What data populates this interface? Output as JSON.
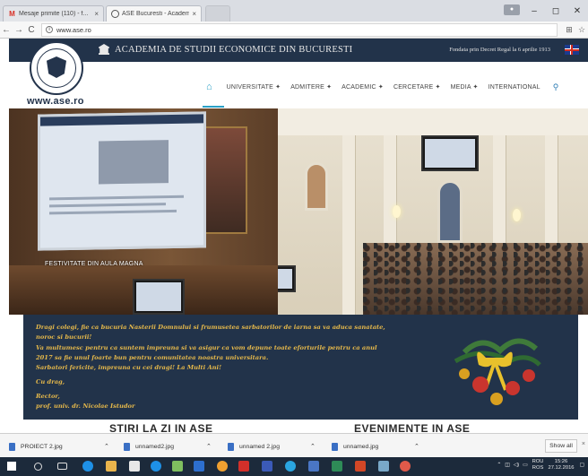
{
  "browser": {
    "tabs": [
      {
        "title": "Mesaje primite (110) - f...",
        "close": "×"
      },
      {
        "title": "ASE Bucuresti - Academ...",
        "close": "×"
      },
      {
        "title": ""
      }
    ],
    "window_buttons": {
      "minimize": "–",
      "maximize": "◻",
      "close": "✕"
    },
    "url": "www.ase.ro",
    "nav": {
      "back": "←",
      "forward": "→",
      "reload": "C"
    }
  },
  "site": {
    "institution": "ACADEMIA DE STUDII ECONOMICE DIN BUCURESTI",
    "founded": "Fondata prin Decret Regal la 6 aprilie 1913",
    "domain_logo": "www.ase.ro",
    "nav_items": [
      "UNIVERSITATE ✦",
      "ADMITERE ✦",
      "ACADEMIC ✦",
      "CERCETARE ✦",
      "MEDIA ✦",
      "INTERNATIONAL"
    ],
    "hero_caption": "FESTIVITATE DIN AULA MAGNA",
    "greeting": {
      "lines": [
        "Dragi colegi, fie ca bucuria Nasterii Domnului si frumusetea sarbatorilor de iarna sa va aduca sanatate,",
        "noroc si bucurii!",
        "Va multumesc pentru ca suntem impreuna si va asigur ca vom depune toate eforturile pentru ca anul",
        "2017 sa fie unul foarte bun pentru comunitatea noastra universitara.",
        "Sarbatori fericite, impreuna cu cei dragi! La Multi Ani!",
        "Cu drag,",
        "Rector,",
        "prof. univ. dr. Nicolae Istudor"
      ]
    },
    "section_headings": [
      "STIRI LA ZI IN ASE",
      "EVENIMENTE IN ASE"
    ]
  },
  "downloads": {
    "items": [
      {
        "name": "PROIECT 2.jpg"
      },
      {
        "name": "unnamed2.jpg"
      },
      {
        "name": "unnamed 2.jpg"
      },
      {
        "name": "unnamed.jpg"
      }
    ],
    "show_all": "Show all",
    "close": "×"
  },
  "taskbar": {
    "lang_top": "ROU",
    "lang_bottom": "ROS",
    "time": "15:26",
    "date": "27.12.2016"
  },
  "colors": {
    "navy": "#22334a",
    "gold_text": "#e5b84a",
    "accent": "#2aa0c6"
  }
}
